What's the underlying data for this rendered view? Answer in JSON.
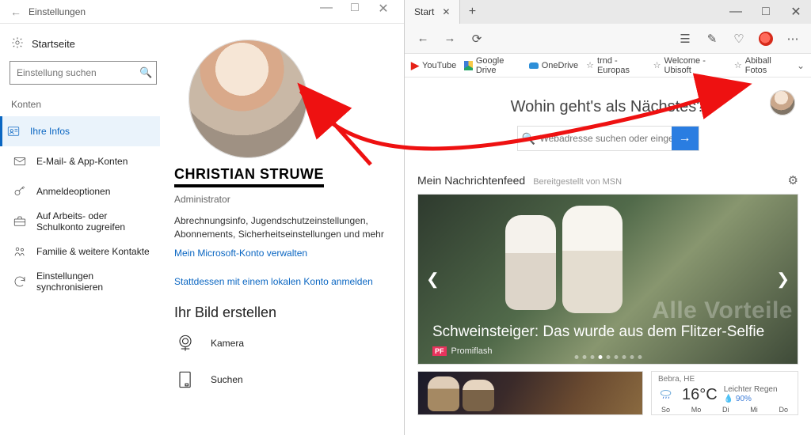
{
  "settings": {
    "window_title": "Einstellungen",
    "home_label": "Startseite",
    "search_placeholder": "Einstellung suchen",
    "category_label": "Konten",
    "nav": [
      {
        "label": "Ihre Infos",
        "icon": "person"
      },
      {
        "label": "E-Mail- & App-Konten",
        "icon": "mail"
      },
      {
        "label": "Anmeldeoptionen",
        "icon": "key"
      },
      {
        "label": "Auf Arbeits- oder Schulkonto zugreifen",
        "icon": "briefcase"
      },
      {
        "label": "Familie & weitere Kontakte",
        "icon": "family"
      },
      {
        "label": "Einstellungen synchronisieren",
        "icon": "sync"
      }
    ],
    "user_name": "CHRISTIAN STRUWE",
    "user_role": "Administrator",
    "billing_desc": "Abrechnungsinfo, Jugendschutzeinstellungen, Abonnements, Sicherheitseinstellungen und mehr",
    "manage_link": "Mein Microsoft-Konto verwalten",
    "local_link": "Stattdessen mit einem lokalen Konto anmelden",
    "pic_heading": "Ihr Bild erstellen",
    "camera_label": "Kamera",
    "browse_label": "Suchen"
  },
  "edge": {
    "tab_title": "Start",
    "toolbar": {},
    "favorites": [
      {
        "label": "YouTube",
        "kind": "yt"
      },
      {
        "label": "Google Drive",
        "kind": "gd"
      },
      {
        "label": "OneDrive",
        "kind": "od"
      },
      {
        "label": "trnd - Europas",
        "kind": "star"
      },
      {
        "label": "Welcome - Ubisoft",
        "kind": "star"
      },
      {
        "label": "Abiball Fotos",
        "kind": "star"
      }
    ],
    "prompt": "Wohin geht's als Nächstes?",
    "search_placeholder": "Webadresse suchen oder eingeben",
    "feed_title": "Mein Nachrichtenfeed",
    "feed_sub": "Bereitgestellt von MSN",
    "hero_headline": "Schweinsteiger: Das wurde aus dem Flitzer-Selfie",
    "hero_source": "Promiflash",
    "hero_bg_text": "Alle Vorteile",
    "weather": {
      "location": "Bebra, HE",
      "temp": "16°C",
      "cond": "Leichter Regen",
      "humidity": "90%",
      "days": [
        "So",
        "Mo",
        "Di",
        "Mi",
        "Do"
      ]
    }
  }
}
